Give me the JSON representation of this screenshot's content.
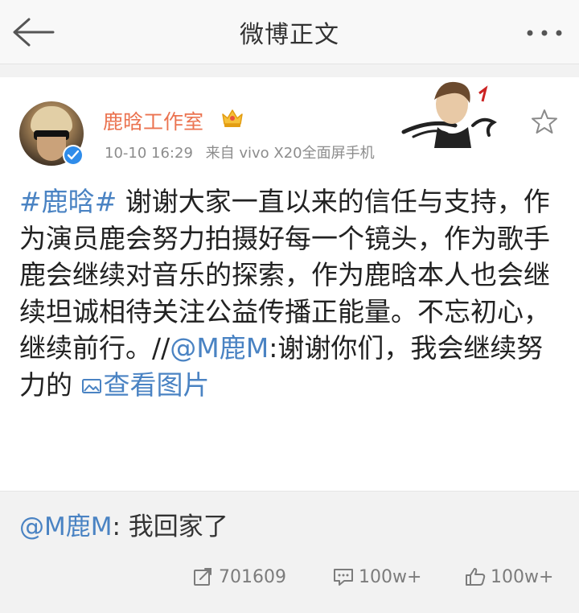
{
  "navbar": {
    "back_icon": "back-arrow-icon",
    "title": "微博正文",
    "more_icon": "more-dots-icon"
  },
  "post": {
    "author": "鹿晗工作室",
    "member_icon": "crown-member-icon",
    "verified_icon": "verified-badge-icon",
    "timestamp": "10-10 16:29",
    "source": "来自 vivo X20全面屏手机",
    "decoration": "deco-card-icon",
    "favorite_icon": "star-icon",
    "text": {
      "hashtag": "#鹿晗#",
      "body": " 谢谢大家一直以来的信任与支持，作为演员鹿会努力拍摄好每一个镜头，作为歌手鹿会继续对音乐的探索，作为鹿晗本人也会继续坦诚相待关注公益传播正能量。不忘初心，继续前行。//",
      "mention": "@M鹿M",
      "mention_body": ":谢谢你们，我会继续努力的 ",
      "view_image_label": "查看图片"
    }
  },
  "retweet": {
    "mention": "@M鹿M",
    "text": ": 我回家了",
    "actions": {
      "repost_count": "701609",
      "comment_count": "100w+",
      "like_count": "100w+"
    }
  },
  "colors": {
    "accent_orange": "#eb7350",
    "link_blue": "#4a83c3",
    "verified_blue": "#2f8cea",
    "background": "#f2f2f2"
  }
}
